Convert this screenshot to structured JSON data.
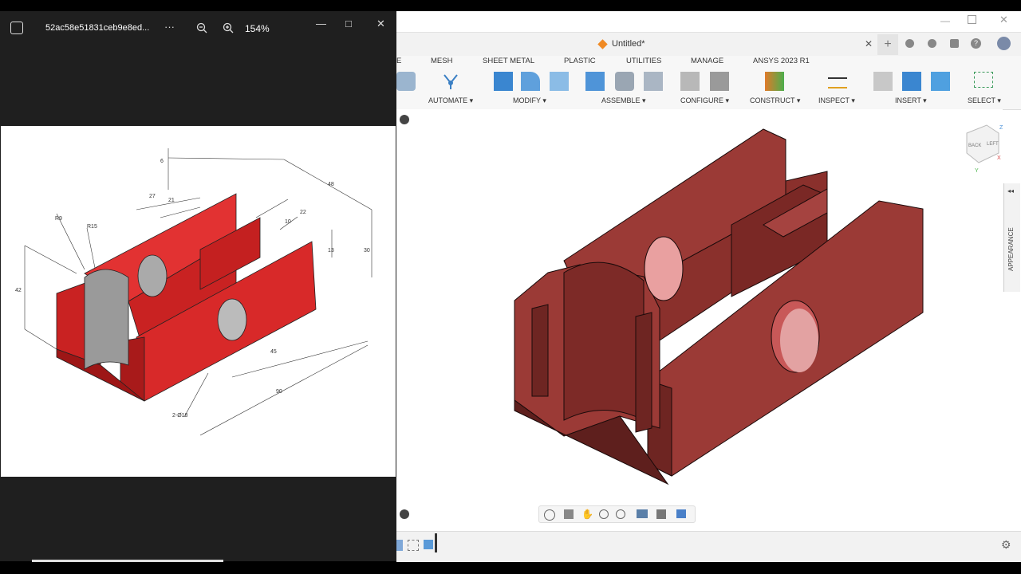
{
  "photos": {
    "title": "52ac58e51831ceb9e8ed...",
    "more": "···",
    "zoom_level": "154%",
    "zoom_out": "zoom-out",
    "zoom_in": "zoom-in",
    "minimize": "—",
    "maximize": "□",
    "close": "✕",
    "drawing_dims": {
      "d6": "6",
      "d48": "48",
      "d27": "27",
      "d21": "21",
      "d22": "22",
      "d10": "10",
      "r9": "R9",
      "r15": "R15",
      "d13": "13",
      "d30": "30",
      "d42": "42",
      "d45": "45",
      "d90": "90",
      "hole": "2-Ø18"
    }
  },
  "fusion": {
    "doc_title": "Untitled*",
    "ribbon_tabs": [
      "E",
      "MESH",
      "SHEET METAL",
      "PLASTIC",
      "UTILITIES",
      "MANAGE",
      "ANSYS 2023 R1"
    ],
    "groups": {
      "automate": "AUTOMATE ▾",
      "modify": "MODIFY ▾",
      "assemble": "ASSEMBLE ▾",
      "configure": "CONFIGURE ▾",
      "construct": "CONSTRUCT ▾",
      "inspect": "INSPECT ▾",
      "insert": "INSERT ▾",
      "select": "SELECT ▾"
    },
    "appearance": "APPEARANCE",
    "viewcube": {
      "back": "BACK",
      "left": "LEFT",
      "z": "Z",
      "x": "X",
      "y": "Y"
    },
    "colors": {
      "model": "#9b3a36",
      "model_dark": "#6e2522",
      "drawing_red": "#d42a2a"
    }
  }
}
